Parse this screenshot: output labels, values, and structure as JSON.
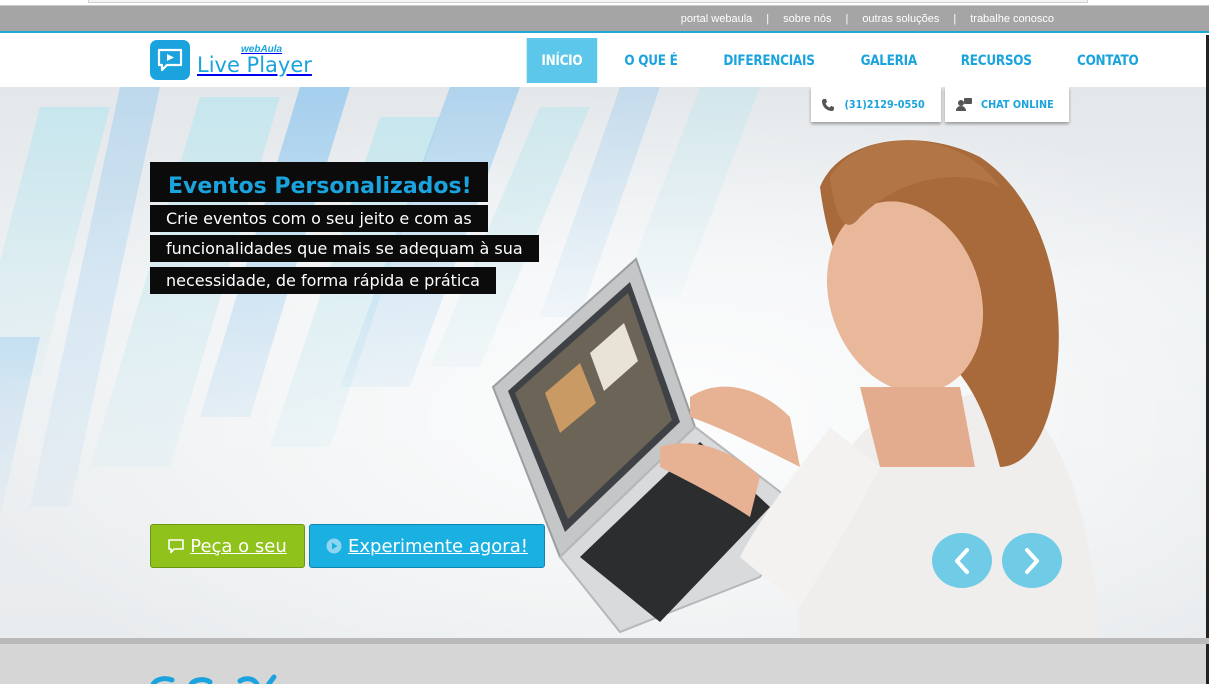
{
  "top_links": [
    "portal webaula",
    "sobre nós",
    "outras soluções",
    "trabalhe conosco"
  ],
  "logo": {
    "small": "webAula",
    "big": "Live Player"
  },
  "nav": [
    {
      "label": "INÍCIO",
      "active": true
    },
    {
      "label": "O QUE É",
      "active": false
    },
    {
      "label": "DIFERENCIAIS",
      "active": false
    },
    {
      "label": "GALERIA",
      "active": false
    },
    {
      "label": "RECURSOS",
      "active": false
    },
    {
      "label": "CONTATO",
      "active": false
    }
  ],
  "contact": {
    "phone": "(31)2129-0550",
    "chat": "CHAT ONLINE"
  },
  "hero": {
    "headline": "Eventos Personalizados!",
    "lines": [
      "Crie eventos com o seu jeito e com as",
      "funcionalidades que mais se adequam à sua",
      "necessidade, de forma rápida e prática"
    ],
    "btn_order": "Peça o seu",
    "btn_try": "Experimente agora!"
  },
  "colors": {
    "accent": "#1aa3dd",
    "green": "#8fc21b",
    "topbar": "#a5a5a5"
  }
}
